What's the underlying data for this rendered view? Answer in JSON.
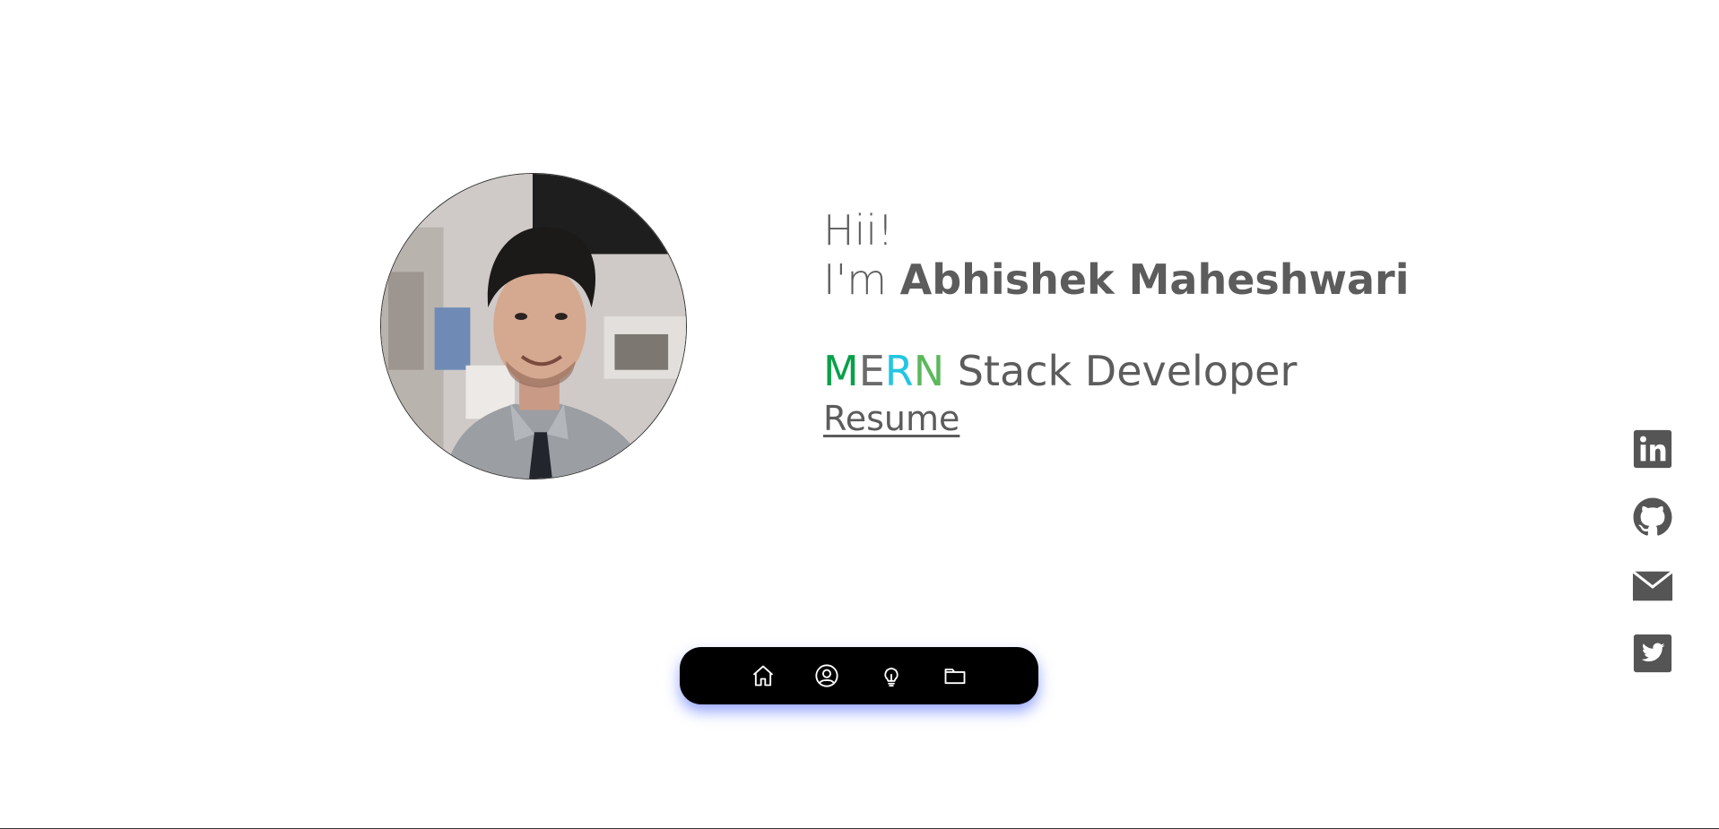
{
  "hero": {
    "greeting": "Hii!",
    "iam_prefix": "I'm ",
    "name": "Abhishek Maheshwari",
    "role_letters": [
      "M",
      "E",
      "R",
      "N"
    ],
    "role_rest": " Stack Developer",
    "resume_label": "Resume",
    "avatar_icon": "profile-photo"
  },
  "colors": {
    "text": "#5c5c5c",
    "mern_m": "#0aa04a",
    "mern_e": "#6b6b6b",
    "mern_r": "#23c6e0",
    "mern_n": "#5cb85c",
    "nav_bg": "#000000",
    "nav_glow": "#405cff",
    "social_icon": "#555555"
  },
  "nav": {
    "items": [
      {
        "icon": "home-icon"
      },
      {
        "icon": "user-circle-icon"
      },
      {
        "icon": "lightbulb-icon"
      },
      {
        "icon": "folder-icon"
      }
    ]
  },
  "social": {
    "items": [
      {
        "icon": "linkedin-icon"
      },
      {
        "icon": "github-icon"
      },
      {
        "icon": "mail-icon"
      },
      {
        "icon": "twitter-icon"
      }
    ]
  }
}
